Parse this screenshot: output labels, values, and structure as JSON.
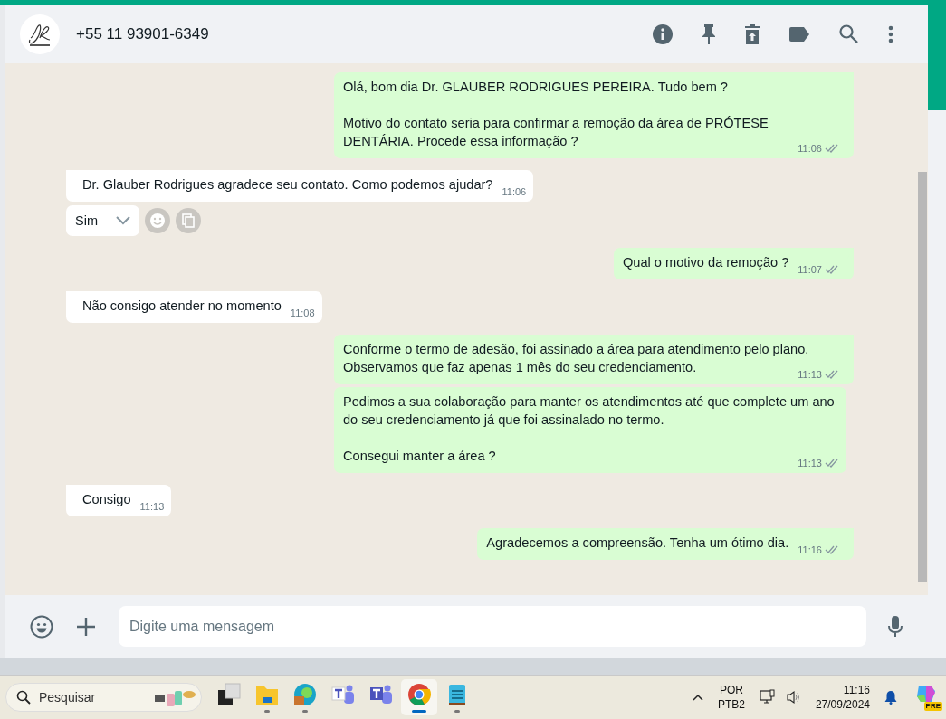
{
  "header": {
    "title": "+55 11 93901-6349"
  },
  "messages": [
    {
      "kind": "outgoing",
      "tail": true,
      "paragraphs": [
        "Olá, bom dia Dr. GLAUBER RODRIGUES PEREIRA. Tudo bem ?",
        "Motivo do contato seria para confirmar a remoção da área de  PRÓTESE DENTÁRIA. Procede essa informação ?"
      ],
      "time": "11:06",
      "delivered": true
    },
    {
      "kind": "incoming",
      "tail": true,
      "paragraphs": [
        "Dr. Glauber Rodrigues agradece seu contato. Como podemos ajudar?"
      ],
      "time": "11:06",
      "reply_select": {
        "value": "Sim"
      }
    },
    {
      "kind": "outgoing",
      "tail": true,
      "paragraphs": [
        "Qual o motivo da remoção ?"
      ],
      "time": "11:07",
      "delivered": true
    },
    {
      "kind": "incoming",
      "tail": true,
      "paragraphs": [
        "Não consigo atender no momento"
      ],
      "time": "11:08"
    },
    {
      "kind": "outgoing",
      "tail": true,
      "paragraphs": [
        "Conforme o termo de adesão, foi assinado a área para atendimento pelo plano. Observamos que faz apenas 1 mês do seu credenciamento."
      ],
      "time": "11:13",
      "delivered": true
    },
    {
      "kind": "outgoing",
      "tail": false,
      "paragraphs": [
        "Pedimos a sua colaboração para manter os atendimentos até que complete um ano do seu credenciamento já que foi assinalado no termo.",
        "Consegui manter a área ?"
      ],
      "time": "11:13",
      "delivered": true
    },
    {
      "kind": "incoming",
      "tail": true,
      "paragraphs": [
        "Consigo"
      ],
      "time": "11:13"
    },
    {
      "kind": "outgoing",
      "tail": true,
      "paragraphs": [
        "Agradecemos a compreensão. Tenha um ótimo dia."
      ],
      "time": "11:16",
      "delivered": true
    }
  ],
  "composer": {
    "placeholder": "Digite uma mensagem"
  },
  "taskbar": {
    "search": {
      "placeholder": "Pesquisar"
    },
    "apps": [
      {
        "kind": "taskview",
        "running": false,
        "selected": false
      },
      {
        "kind": "folder",
        "running": true,
        "selected": false
      },
      {
        "kind": "edge",
        "running": true,
        "selected": false
      },
      {
        "kind": "teams",
        "running": false,
        "selected": false
      },
      {
        "kind": "teams2",
        "running": false,
        "selected": false
      },
      {
        "kind": "chrome",
        "running": true,
        "selected": true
      },
      {
        "kind": "notepad",
        "running": true,
        "selected": false
      }
    ],
    "language": [
      "POR",
      "PTB2"
    ],
    "time": "11:16",
    "date": "27/09/2024",
    "copilot_badge": "PRE"
  }
}
